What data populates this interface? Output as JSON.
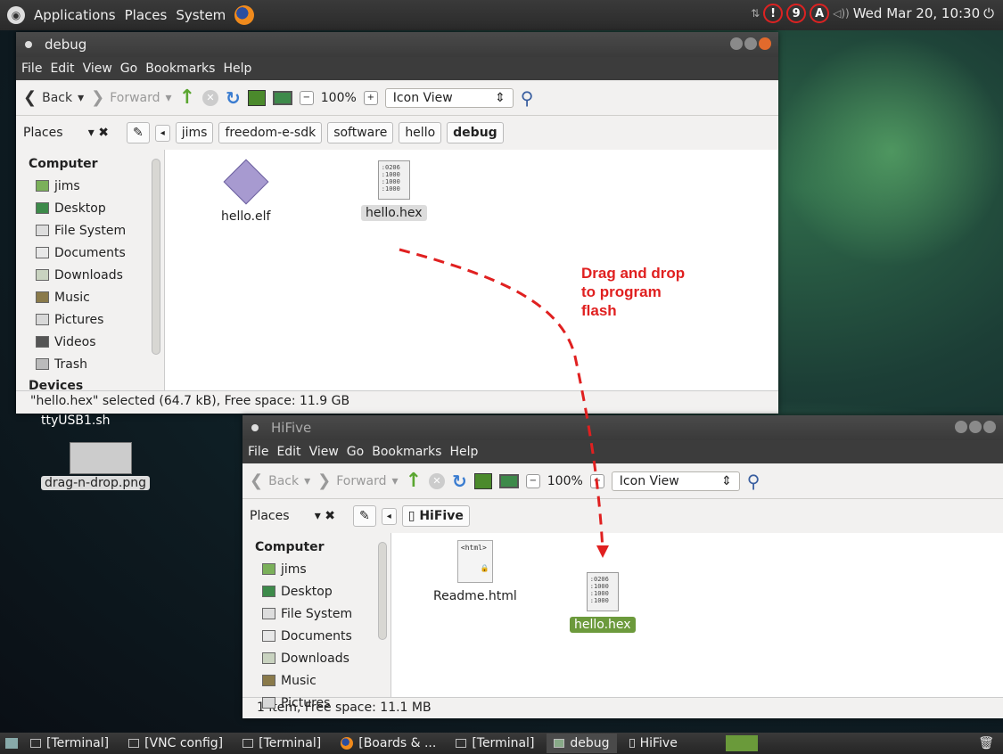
{
  "top_panel": {
    "menus": [
      "Applications",
      "Places",
      "System"
    ],
    "tray": [
      "!",
      "9",
      "A"
    ],
    "clock": "Wed Mar 20, 10:30"
  },
  "win1": {
    "title": "debug",
    "menu": [
      "File",
      "Edit",
      "View",
      "Go",
      "Bookmarks",
      "Help"
    ],
    "back": "Back",
    "forward": "Forward",
    "zoom": "100%",
    "view": "Icon View",
    "places": "Places",
    "breadcrumbs": [
      "jims",
      "freedom-e-sdk",
      "software",
      "hello",
      "debug"
    ],
    "sidebar_groups": [
      "Computer",
      "Devices"
    ],
    "sidebar_items": [
      "jims",
      "Desktop",
      "File System",
      "Documents",
      "Downloads",
      "Music",
      "Pictures",
      "Videos",
      "Trash"
    ],
    "files": [
      "hello.elf",
      "hello.hex"
    ],
    "status": "\"hello.hex\" selected (64.7 kB), Free space: 11.9 GB"
  },
  "win2": {
    "title": "HiFive",
    "menu": [
      "File",
      "Edit",
      "View",
      "Go",
      "Bookmarks",
      "Help"
    ],
    "back": "Back",
    "forward": "Forward",
    "zoom": "100%",
    "view": "Icon View",
    "places": "Places",
    "breadcrumbs": [
      "HiFive"
    ],
    "sidebar_groups": [
      "Computer"
    ],
    "sidebar_items": [
      "jims",
      "Desktop",
      "File System",
      "Documents",
      "Downloads",
      "Music",
      "Pictures"
    ],
    "files": [
      "Readme.html",
      "hello.hex"
    ],
    "status": "1 item, Free space: 11.1 MB"
  },
  "desktop": {
    "items": [
      "ttyUSB1.sh",
      "drag-n-drop.png"
    ]
  },
  "annotation": {
    "lines": [
      "Drag and drop",
      "to program",
      "flash"
    ],
    "color": "#e02020"
  },
  "hex_preview": [
    ":0206",
    ":1000",
    ":1000",
    ":1000"
  ],
  "html_preview": "<html>",
  "taskbar": {
    "items": [
      "[Terminal]",
      "[VNC config]",
      "[Terminal]",
      "[Boards & ...",
      "[Terminal]",
      "debug",
      "HiFive"
    ]
  }
}
